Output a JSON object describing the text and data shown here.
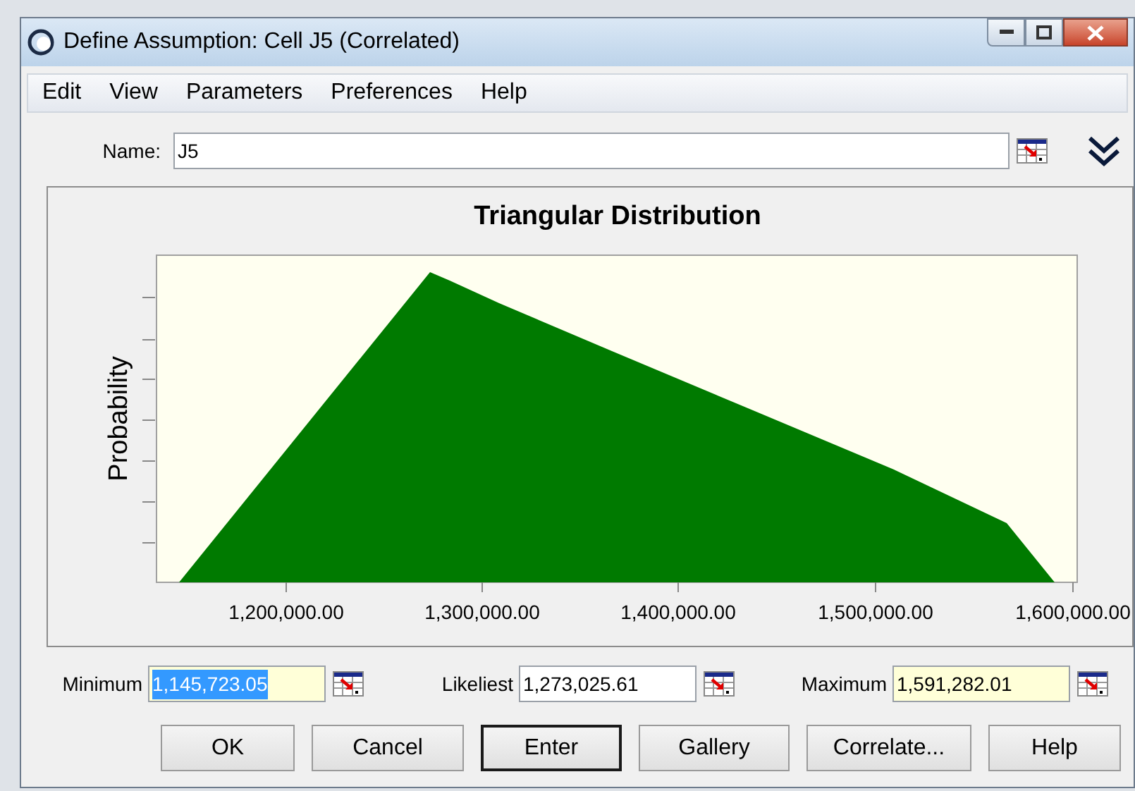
{
  "window": {
    "title": "Define Assumption: Cell J5 (Correlated)"
  },
  "menu": [
    "Edit",
    "View",
    "Parameters",
    "Preferences",
    "Help"
  ],
  "name_field": {
    "label": "Name:",
    "value": "J5"
  },
  "chart": {
    "title": "Triangular Distribution",
    "ylabel": "Probability",
    "xtick_labels": [
      "1,200,000.00",
      "1,300,000.00",
      "1,400,000.00",
      "1,500,000.00",
      "1,600,000.00"
    ]
  },
  "parameters": [
    {
      "label": "Minimum",
      "value": "1,145,723.05",
      "text_selected": true,
      "tinted": true
    },
    {
      "label": "Likeliest",
      "value": "1,273,025.61",
      "text_selected": false,
      "tinted": false
    },
    {
      "label": "Maximum",
      "value": "1,591,282.01",
      "text_selected": false,
      "tinted": true
    }
  ],
  "buttons": [
    {
      "label": "OK",
      "default": false
    },
    {
      "label": "Cancel",
      "default": false
    },
    {
      "label": "Enter",
      "default": true
    },
    {
      "label": "Gallery",
      "default": false
    },
    {
      "label": "Correlate...",
      "default": false
    },
    {
      "label": "Help",
      "default": false
    }
  ]
}
